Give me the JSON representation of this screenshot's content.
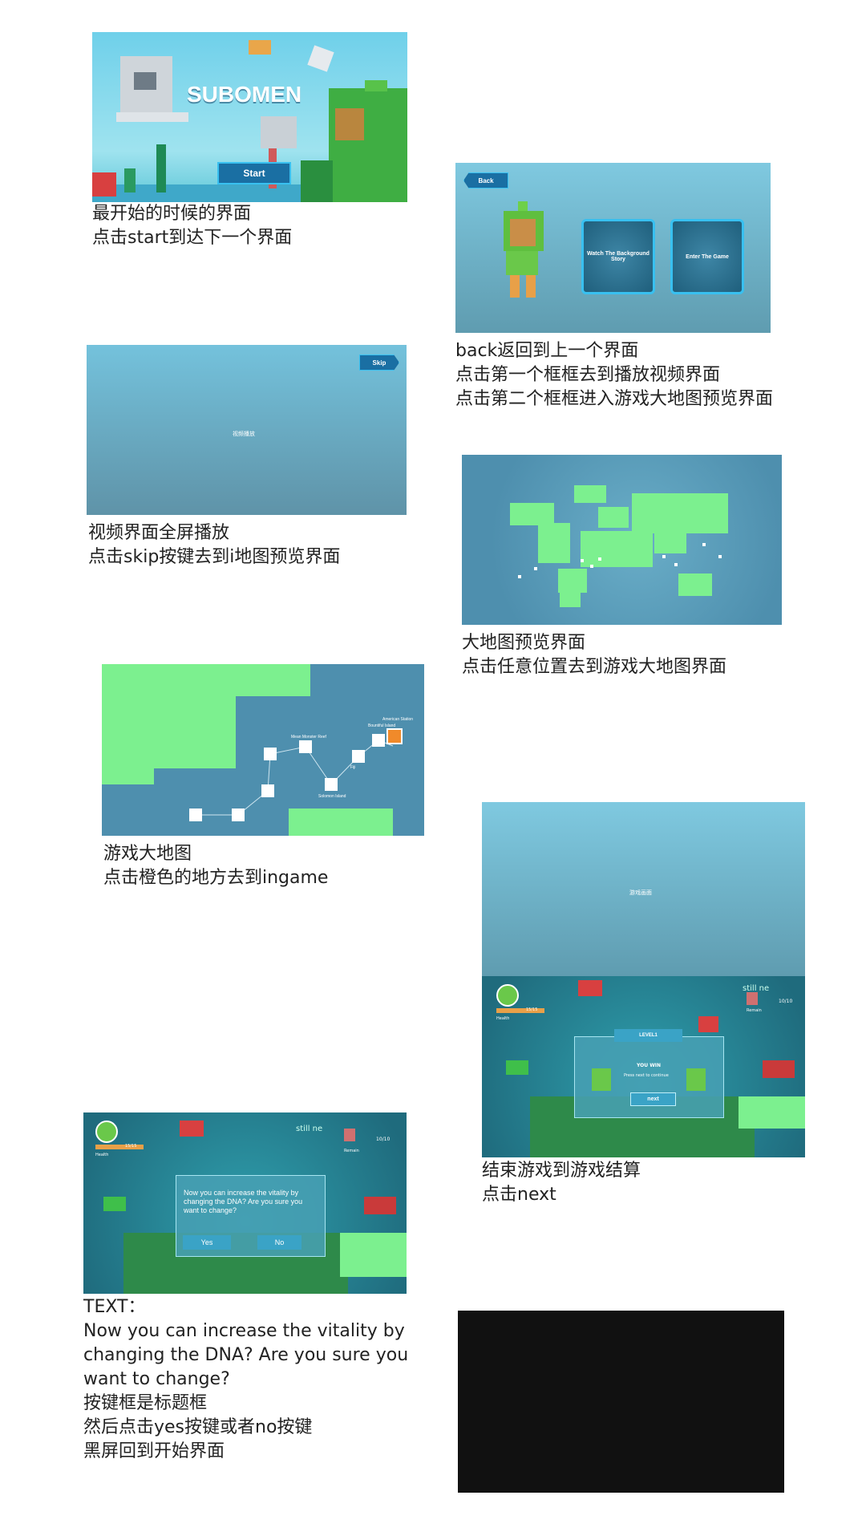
{
  "screen1": {
    "logo": "SUBOMEN",
    "start_label": "Start",
    "caption": "最开始的时候的界面\n点击start到达下一个界面"
  },
  "screen2": {
    "back_label": "Back",
    "card1_label": "Watch The Background Story",
    "card2_label": "Enter The Game",
    "caption": "back返回到上一个界面\n点击第一个框框去到播放视频界面\n点击第二个框框进入游戏大地图预览界面"
  },
  "screen3": {
    "skip_label": "Skip",
    "center_text": "视频播放",
    "caption": "视频界面全屏播放\n点击skip按键去到i地图预览界面"
  },
  "screen4": {
    "caption": "大地图预览界面\n点击任意位置去到游戏大地图界面"
  },
  "screen5": {
    "node_labels": [
      "Mean Monster Reef",
      "Bountiful Island",
      "American Station",
      "Fiji",
      "Solomon Island"
    ],
    "caption": "游戏大地图\n点击橙色的地方去到ingame"
  },
  "screen6": {
    "center_text": "游戏画面",
    "level_label": "LEVEL1",
    "you_win": "YOU WIN",
    "instruction": "Press next to continue",
    "next_label": "next",
    "health_label": "Health",
    "health_value": "15/15",
    "remain_label": "Remain",
    "remain_value": "10/10",
    "bg_text": "still ne",
    "caption": "结束游戏到游戏结算\n点击next"
  },
  "screen7": {
    "dialog_text": "Now you can increase the vitality by changing the DNA? Are you sure you want to change?",
    "yes_label": "Yes",
    "no_label": "No",
    "health_label": "Health",
    "health_value": "15/15",
    "remain_label": "Remain",
    "remain_value": "10/10",
    "bg_text": "still ne",
    "caption": "TEXT：\nNow you can increase the vitality by changing the DNA? Are you sure you want to change?\n按键框是标题框\n然后点击yes按键或者no按键\n黑屏回到开始界面"
  },
  "colors": {
    "sky_top": "#7fd3ea",
    "sky_bottom": "#5f93a8",
    "land_green": "#7cf08f",
    "map_blue": "#4e8fae",
    "button_blue": "#1a6fa3",
    "button_border": "#38c0f0",
    "black_screen": "#111111"
  }
}
